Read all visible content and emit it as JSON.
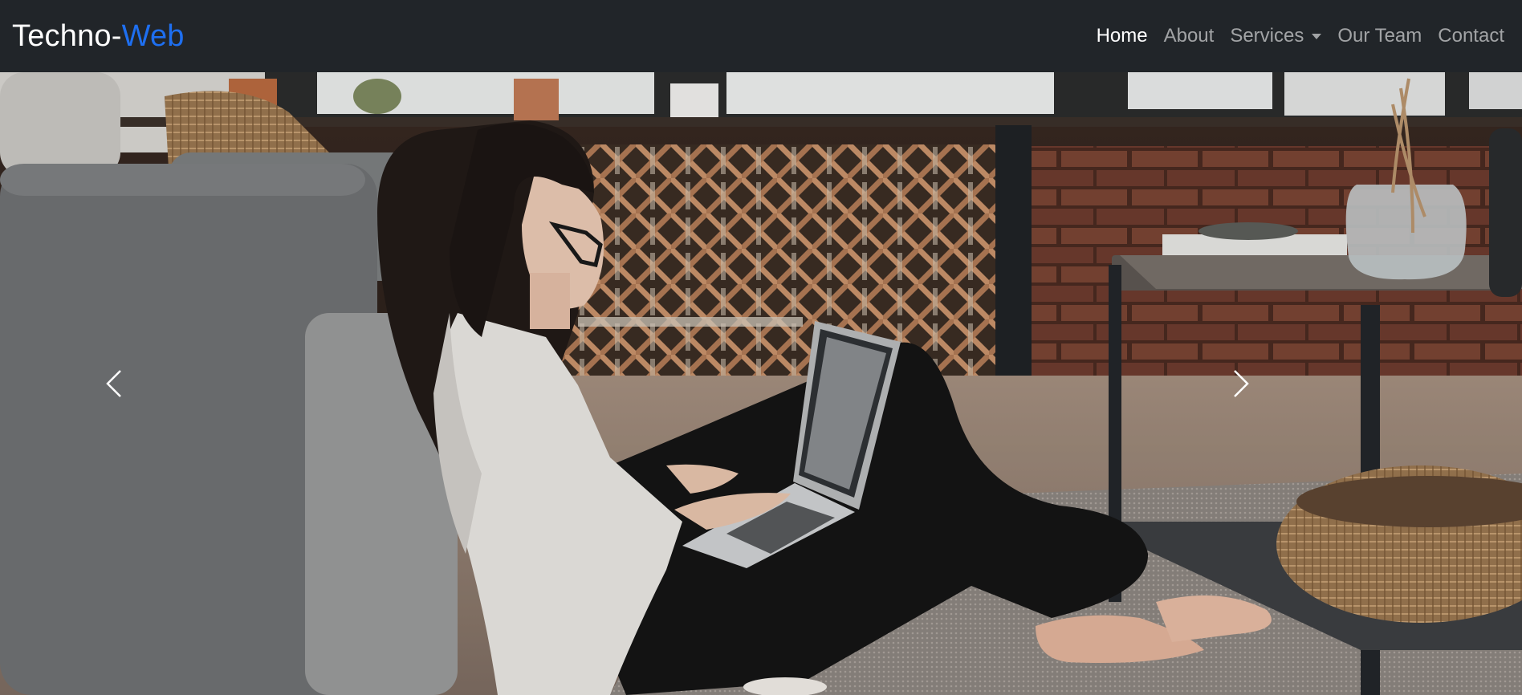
{
  "brand": {
    "primary": "Techno-",
    "accent": "Web",
    "accent_color": "#1e6ff0"
  },
  "nav": {
    "items": [
      {
        "label": "Home",
        "active": true
      },
      {
        "label": "About"
      },
      {
        "label": "Services",
        "dropdown": true
      },
      {
        "label": "Our Team"
      },
      {
        "label": "Contact"
      }
    ]
  },
  "hero": {
    "image": "woman sitting on floor working on laptop in living room",
    "prev_icon": "chevron-left-icon",
    "next_icon": "chevron-right-icon"
  },
  "colors": {
    "navbar_bg": "#212529",
    "nav_active": "#ffffff",
    "nav_inactive": "#9a9c9f"
  }
}
